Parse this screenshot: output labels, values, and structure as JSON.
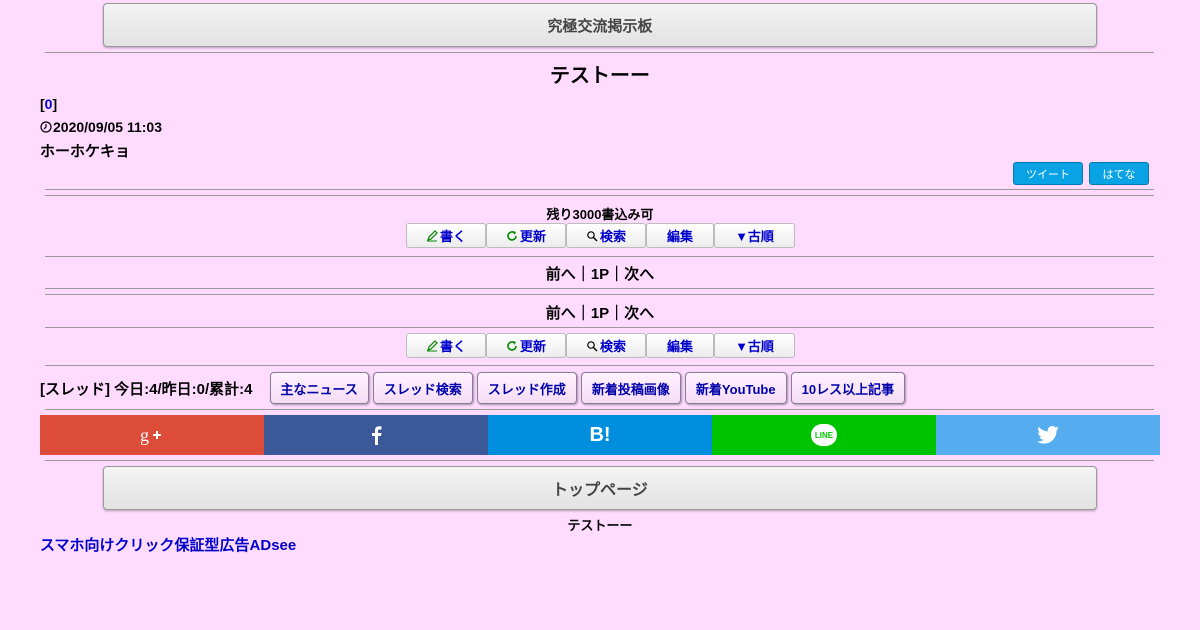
{
  "header": {
    "board_name": "究極交流掲示板"
  },
  "thread": {
    "title": "テストーー",
    "post": {
      "number_prefix": "[",
      "number": "0",
      "number_suffix": "]",
      "date": "2020/09/05 11:03",
      "body": "ホーホケキョ"
    },
    "share": {
      "tweet_label": "ツイート",
      "hatena_label": "はてな"
    }
  },
  "remaining": "残り3000書込み可",
  "toolbar": {
    "write": "書く",
    "refresh": "更新",
    "search": "検索",
    "edit": "編集",
    "order": "▼古順"
  },
  "pager": {
    "prev": "前へ",
    "sep1": "｜",
    "page": "1P",
    "sep2": "｜",
    "next": "次へ"
  },
  "stats": {
    "label": "[スレッド] 今日:4/昨日:0/累計:4"
  },
  "nav_buttons": [
    "主なニュース",
    "スレッド検索",
    "スレッド作成",
    "新着投稿画像",
    "新着YouTube",
    "10レス以上記事"
  ],
  "social": {
    "colors": {
      "gplus": "#dd4b39",
      "facebook": "#3b5998",
      "hatena": "#008fde",
      "line": "#00c300",
      "twitter": "#55acee"
    },
    "hatena_text": "B!",
    "line_text": "LINE"
  },
  "footer": {
    "top_page": "トップページ",
    "thread_title": "テストーー",
    "ad_link": "スマホ向けクリック保証型広告ADsee"
  }
}
